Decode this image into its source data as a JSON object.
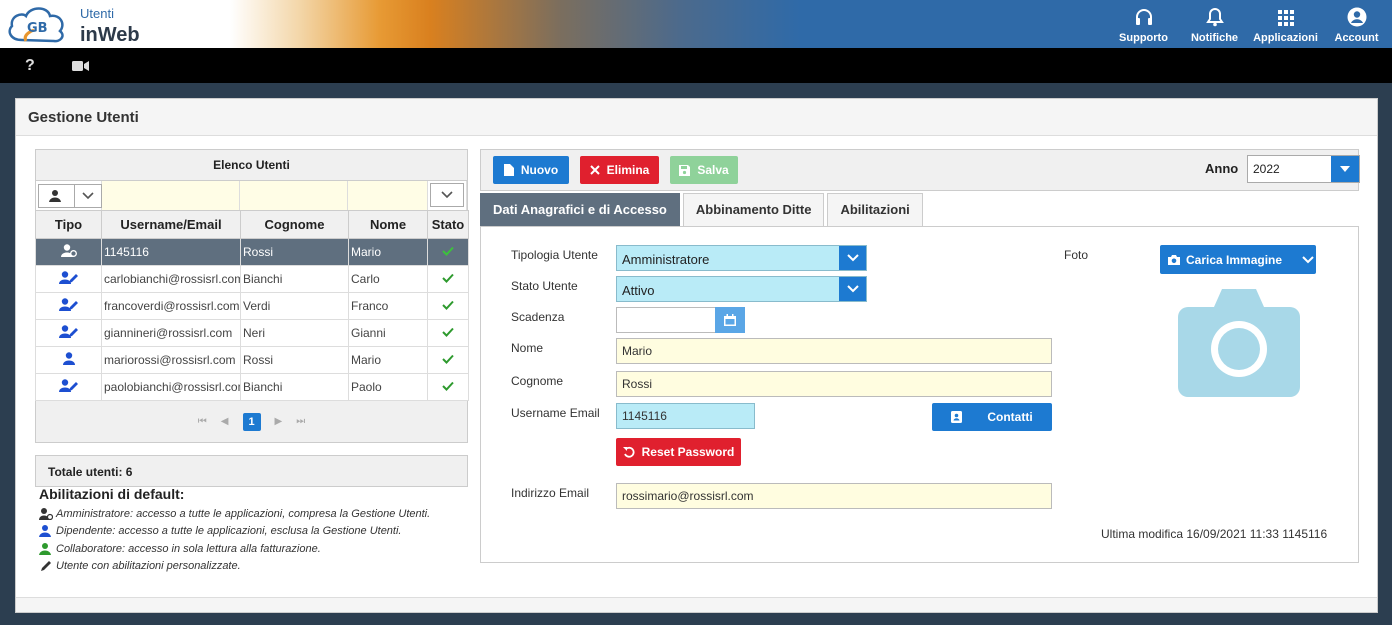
{
  "app": {
    "logo_line1": "Utenti",
    "logo_line2": "inWeb",
    "logo_badge": "GB"
  },
  "topnav": [
    {
      "label": "Supporto",
      "icon": "headset-icon"
    },
    {
      "label": "Notifiche",
      "icon": "bell-icon"
    },
    {
      "label": "Applicazioni",
      "icon": "grid-icon"
    },
    {
      "label": "Account",
      "icon": "account-icon"
    }
  ],
  "subbar": {
    "help": "?",
    "video_icon": "video-camera-icon"
  },
  "page": {
    "title": "Gestione Utenti"
  },
  "users_list": {
    "title": "Elenco Utenti",
    "columns": [
      "Tipo",
      "Username/Email",
      "Cognome",
      "Nome",
      "Stato"
    ],
    "rows": [
      {
        "type": "admin",
        "username": "1145116",
        "surname": "Rossi",
        "name": "Mario",
        "active": true,
        "selected": true
      },
      {
        "type": "custom",
        "username": "carlobianchi@rossisrl.com",
        "surname": "Bianchi",
        "name": "Carlo",
        "active": true
      },
      {
        "type": "custom",
        "username": "francoverdi@rossisrl.com",
        "surname": "Verdi",
        "name": "Franco",
        "active": true
      },
      {
        "type": "custom",
        "username": "giannineri@rossisrl.com",
        "surname": "Neri",
        "name": "Gianni",
        "active": true
      },
      {
        "type": "employee",
        "username": "mariorossi@rossisrl.com",
        "surname": "Rossi",
        "name": "Mario",
        "active": true
      },
      {
        "type": "custom",
        "username": "paolobianchi@rossisrl.com",
        "surname": "Bianchi",
        "name": "Paolo",
        "active": true
      }
    ],
    "pager": {
      "current": "1"
    },
    "total_label": "Totale utenti: 6"
  },
  "legend": {
    "title": "Abilitazioni di default:",
    "items": [
      {
        "icon": "admin-user-icon",
        "text": "Amministratore: accesso a tutte le applicazioni, compresa la Gestione Utenti."
      },
      {
        "icon": "employee-user-icon",
        "text": "Dipendente: accesso a tutte le applicazioni, esclusa la Gestione Utenti."
      },
      {
        "icon": "collaborator-user-icon",
        "text": "Collaboratore: accesso in sola lettura alla fatturazione."
      },
      {
        "icon": "pencil-icon",
        "text": "Utente con abilitazioni personalizzate."
      }
    ]
  },
  "toolbar": {
    "new_label": "Nuovo",
    "delete_label": "Elimina",
    "save_label": "Salva",
    "year_label": "Anno",
    "year_value": "2022"
  },
  "tabs": [
    {
      "label": "Dati Anagrafici e di Accesso",
      "active": true
    },
    {
      "label": "Abbinamento Ditte",
      "active": false
    },
    {
      "label": "Abilitazioni",
      "active": false
    }
  ],
  "form": {
    "tipologia_label": "Tipologia Utente",
    "tipologia_value": "Amministratore",
    "stato_label": "Stato Utente",
    "stato_value": "Attivo",
    "scadenza_label": "Scadenza",
    "scadenza_value": "",
    "nome_label": "Nome",
    "nome_value": "Mario",
    "cognome_label": "Cognome",
    "cognome_value": "Rossi",
    "username_label": "Username Email",
    "username_value": "1145116",
    "contatti_label": "Contatti",
    "reset_label": "Reset Password",
    "email_label": "Indirizzo Email",
    "email_value": "rossimario@rossisrl.com",
    "foto_label": "Foto",
    "upload_label": "Carica Immagine",
    "last_modified": "Ultima modifica 16/09/2021 11:33 1145116"
  },
  "colors": {
    "primary": "#1d7ad1",
    "danger": "#e0202e",
    "success_disabled": "#8fd29a",
    "selected_row": "#5f6f7f",
    "check": "#2e9a2e"
  }
}
